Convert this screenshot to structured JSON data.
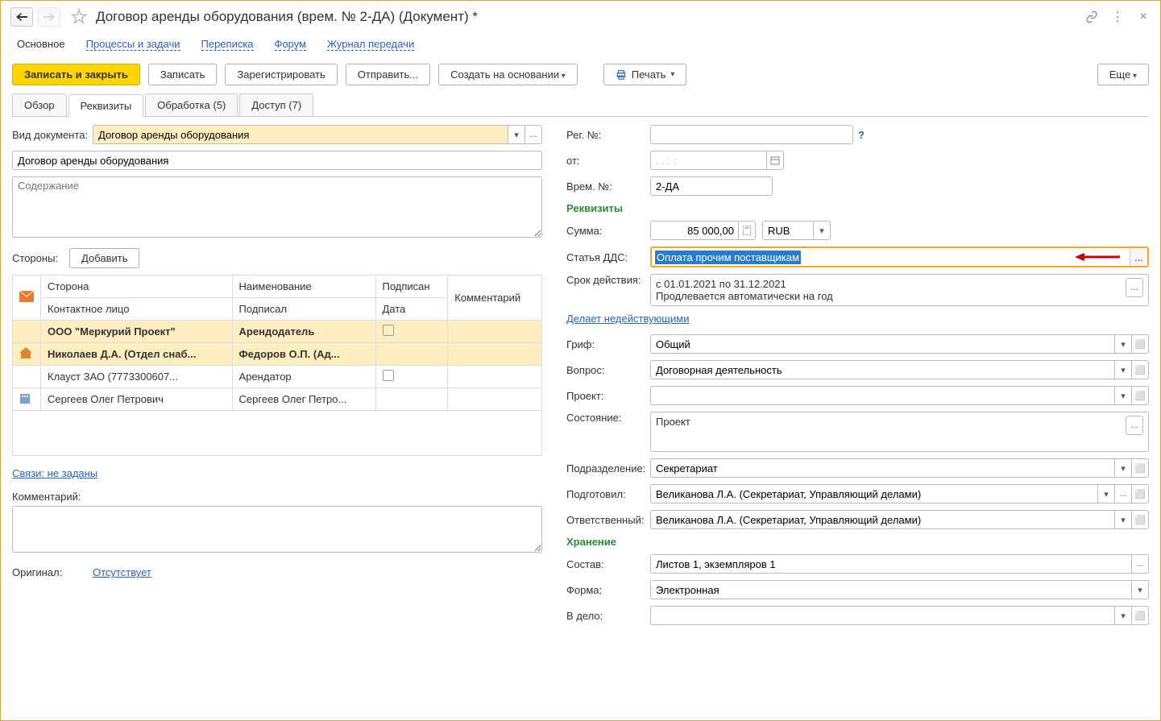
{
  "title": "Договор аренды оборудования (врем. № 2-ДА) (Документ) *",
  "nav": {
    "main": "Основное",
    "processes": "Процессы и задачи",
    "mail": "Переписка",
    "forum": "Форум",
    "journal": "Журнал передачи"
  },
  "toolbar": {
    "save_close": "Записать и закрыть",
    "save": "Записать",
    "register": "Зарегистрировать",
    "send": "Отправить...",
    "create_based": "Создать на основании",
    "print": "Печать",
    "more": "Еще"
  },
  "tabs": {
    "overview": "Обзор",
    "requisites": "Реквизиты",
    "processing": "Обработка (5)",
    "access": "Доступ (7)"
  },
  "left": {
    "doc_type_label": "Вид документа:",
    "doc_type_value": "Договор аренды оборудования",
    "doc_name": "Договор аренды оборудования",
    "content_placeholder": "Содержание",
    "parties_label": "Стороны:",
    "add_button": "Добавить",
    "headers": {
      "party": "Сторона",
      "name": "Наименование",
      "signed": "Подписан",
      "comment": "Комментарий",
      "contact": "Контактное лицо",
      "signed_by": "Подписал",
      "date": "Дата"
    },
    "rows": [
      {
        "icon": "house",
        "party": "ООО \"Меркурий Проект\"",
        "name": "Арендодатель",
        "check": true,
        "bold": true
      },
      {
        "icon": "house",
        "party": "Николаев Д.А. (Отдел снаб...",
        "name": "Федоров О.П. (Ад...",
        "check": false,
        "bold": true
      },
      {
        "icon": "",
        "party": "Клауст ЗАО (7773300607...",
        "name": "Арендатор",
        "check": true,
        "bold": false
      },
      {
        "icon": "building",
        "party": "Сергеев Олег Петрович",
        "name": "Сергеев Олег Петро...",
        "check": false,
        "bold": false
      }
    ],
    "links_label": "Связи: не заданы",
    "comment_label": "Комментарий:",
    "original_label": "Оригинал:",
    "original_value": "Отсутствует"
  },
  "right": {
    "reg_no_label": "Рег. №:",
    "from_label": "от:",
    "date_placeholder": ". . : :",
    "temp_no_label": "Врем. №:",
    "temp_no_value": "2-ДА",
    "requisites_head": "Реквизиты",
    "sum_label": "Сумма:",
    "sum_value": "85 000,00",
    "currency": "RUB",
    "dds_label": "Статья ДДС:",
    "dds_value": "Оплата прочим поставщикам",
    "duration_label": "Срок действия:",
    "duration_line1": "с 01.01.2021 по 31.12.2021",
    "duration_line2": "Продлевается автоматически на год",
    "makes_void": "Делает недействующими",
    "grif_label": "Гриф:",
    "grif_value": "Общий",
    "question_label": "Вопрос:",
    "question_value": "Договорная деятельность",
    "project_label": "Проект:",
    "state_label": "Состояние:",
    "state_value": "Проект",
    "dept_label": "Подразделение:",
    "dept_value": "Секретариат",
    "prepared_label": "Подготовил:",
    "prepared_value": "Великанова Л.А. (Секретариат, Управляющий делами)",
    "responsible_label": "Ответственный:",
    "responsible_value": "Великанова Л.А. (Секретариат, Управляющий делами)",
    "storage_head": "Хранение",
    "composition_label": "Состав:",
    "composition_value": "Листов 1, экземпляров 1",
    "form_label": "Форма:",
    "form_value": "Электронная",
    "to_case_label": "В дело:"
  }
}
